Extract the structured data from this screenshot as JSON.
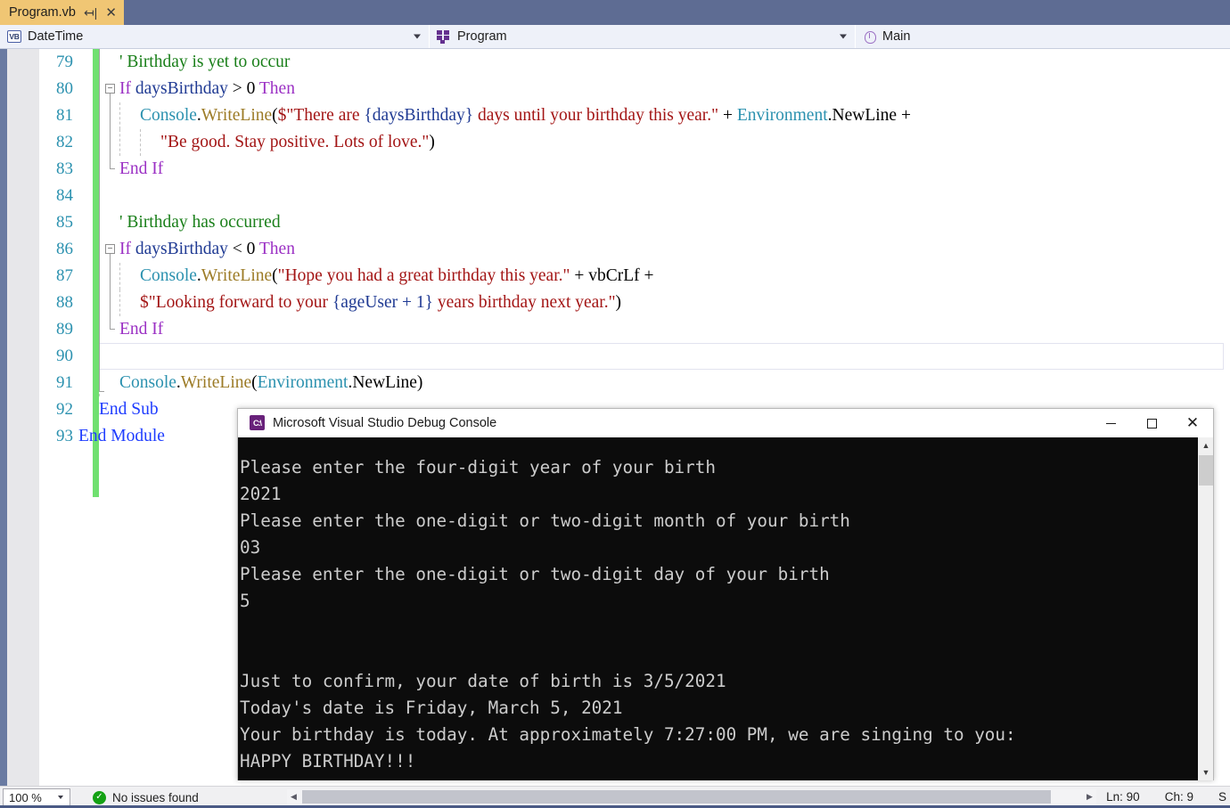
{
  "tab": {
    "label": "Program.vb",
    "pin_icon": "pin-icon",
    "close_icon": "close-icon"
  },
  "navbar": {
    "segments": [
      {
        "icon": "vb-file-icon",
        "icon_text": "VB",
        "label": "DateTime",
        "has_dropdown": true
      },
      {
        "icon": "module-icon",
        "label": "Program",
        "has_dropdown": true
      },
      {
        "icon": "method-icon",
        "label": "Main",
        "has_dropdown": false
      }
    ]
  },
  "editor": {
    "lines": [
      {
        "num": "79",
        "indent": 2,
        "segs": [
          {
            "c": "cmt",
            "t": "' Birthday is yet to occur"
          }
        ]
      },
      {
        "num": "80",
        "indent": 2,
        "outline": "minus",
        "segs": [
          {
            "c": "kw",
            "t": "If"
          },
          {
            "c": "plain",
            "t": " "
          },
          {
            "c": "ident",
            "t": "daysBirthday"
          },
          {
            "c": "plain",
            "t": " > 0 "
          },
          {
            "c": "kw",
            "t": "Then"
          }
        ]
      },
      {
        "num": "81",
        "indent": 3,
        "segs": [
          {
            "c": "type",
            "t": "Console"
          },
          {
            "c": "punct",
            "t": "."
          },
          {
            "c": "meth",
            "t": "WriteLine"
          },
          {
            "c": "punct",
            "t": "("
          },
          {
            "c": "str",
            "t": "$\"There are "
          },
          {
            "c": "ident",
            "t": "{daysBirthday}"
          },
          {
            "c": "str",
            "t": " days until your birthday this year.\""
          },
          {
            "c": "plain",
            "t": " + "
          },
          {
            "c": "type",
            "t": "Environment"
          },
          {
            "c": "punct",
            "t": "."
          },
          {
            "c": "plain",
            "t": "NewLine +"
          }
        ]
      },
      {
        "num": "82",
        "indent": 4,
        "segs": [
          {
            "c": "str",
            "t": "\"Be good. Stay positive. Lots of love.\""
          },
          {
            "c": "punct",
            "t": ")"
          }
        ]
      },
      {
        "num": "83",
        "indent": 2,
        "segs": [
          {
            "c": "kw",
            "t": "End If"
          }
        ]
      },
      {
        "num": "84",
        "indent": 2,
        "segs": []
      },
      {
        "num": "85",
        "indent": 2,
        "segs": [
          {
            "c": "cmt",
            "t": "' Birthday has occurred"
          }
        ]
      },
      {
        "num": "86",
        "indent": 2,
        "outline": "minus",
        "segs": [
          {
            "c": "kw",
            "t": "If"
          },
          {
            "c": "plain",
            "t": " "
          },
          {
            "c": "ident",
            "t": "daysBirthday"
          },
          {
            "c": "plain",
            "t": " < 0 "
          },
          {
            "c": "kw",
            "t": "Then"
          }
        ]
      },
      {
        "num": "87",
        "indent": 3,
        "segs": [
          {
            "c": "type",
            "t": "Console"
          },
          {
            "c": "punct",
            "t": "."
          },
          {
            "c": "meth",
            "t": "WriteLine"
          },
          {
            "c": "punct",
            "t": "("
          },
          {
            "c": "str",
            "t": "\"Hope you had a great birthday this year.\""
          },
          {
            "c": "plain",
            "t": " + vbCrLf +"
          }
        ]
      },
      {
        "num": "88",
        "indent": 3,
        "segs": [
          {
            "c": "str",
            "t": "$\"Looking forward to your "
          },
          {
            "c": "ident",
            "t": "{ageUser + 1}"
          },
          {
            "c": "str",
            "t": " years birthday next year.\""
          },
          {
            "c": "punct",
            "t": ")"
          }
        ]
      },
      {
        "num": "89",
        "indent": 2,
        "segs": [
          {
            "c": "kw",
            "t": "End If"
          }
        ]
      },
      {
        "num": "90",
        "indent": 2,
        "current": true,
        "segs": []
      },
      {
        "num": "91",
        "indent": 2,
        "segs": [
          {
            "c": "type",
            "t": "Console"
          },
          {
            "c": "punct",
            "t": "."
          },
          {
            "c": "meth",
            "t": "WriteLine"
          },
          {
            "c": "punct",
            "t": "("
          },
          {
            "c": "type",
            "t": "Environment"
          },
          {
            "c": "punct",
            "t": "."
          },
          {
            "c": "plain",
            "t": "NewLine)"
          }
        ]
      },
      {
        "num": "92",
        "indent": 1,
        "segs": [
          {
            "c": "kwblue",
            "t": "End Sub"
          }
        ]
      },
      {
        "num": "93",
        "indent": 0,
        "segs": [
          {
            "c": "kwblue",
            "t": "End Module"
          }
        ]
      }
    ]
  },
  "console_window": {
    "title": "Microsoft Visual Studio Debug Console",
    "app_icon": "console-app-icon",
    "app_icon_text": "C:\\",
    "minimize_icon": "minimize-icon",
    "maximize_icon": "maximize-icon",
    "close_icon": "close-icon",
    "output": "Please enter the four-digit year of your birth\n2021\nPlease enter the one-digit or two-digit month of your birth\n03\nPlease enter the one-digit or two-digit day of your birth\n5\n\n\nJust to confirm, your date of birth is 3/5/2021\nToday's date is Friday, March 5, 2021\nYour birthday is today. At approximately 7:27:00 PM, we are singing to you:\nHAPPY BIRTHDAY!!!",
    "scroll_up_icon": "chevron-up-icon",
    "scroll_down_icon": "chevron-down-icon"
  },
  "statusbar": {
    "zoom": "100 %",
    "zoom_dropdown_icon": "chevron-down-icon",
    "issues_icon": "check-circle-icon",
    "issues_text": "No issues found",
    "scroll_left_icon": "triangle-left-icon",
    "scroll_right_icon": "triangle-right-icon",
    "line": "Ln: 90",
    "column": "Ch: 9",
    "insert_mode": "S"
  },
  "colors": {
    "tab_active": "#f0c674",
    "tabstrip": "#5e6c93",
    "navbar": "#eef1f9",
    "changebar_green": "#70e070",
    "console_bg": "#0c0c0c",
    "console_fg": "#cccccc",
    "linenumber": "#2b91af",
    "keyword": "#9b30c4",
    "keyword_blue": "#1e3cff",
    "comment": "#1a7f1a",
    "string": "#a31515",
    "type": "#2b91af",
    "method": "#9c7b26",
    "identifier": "#1f3a93"
  }
}
